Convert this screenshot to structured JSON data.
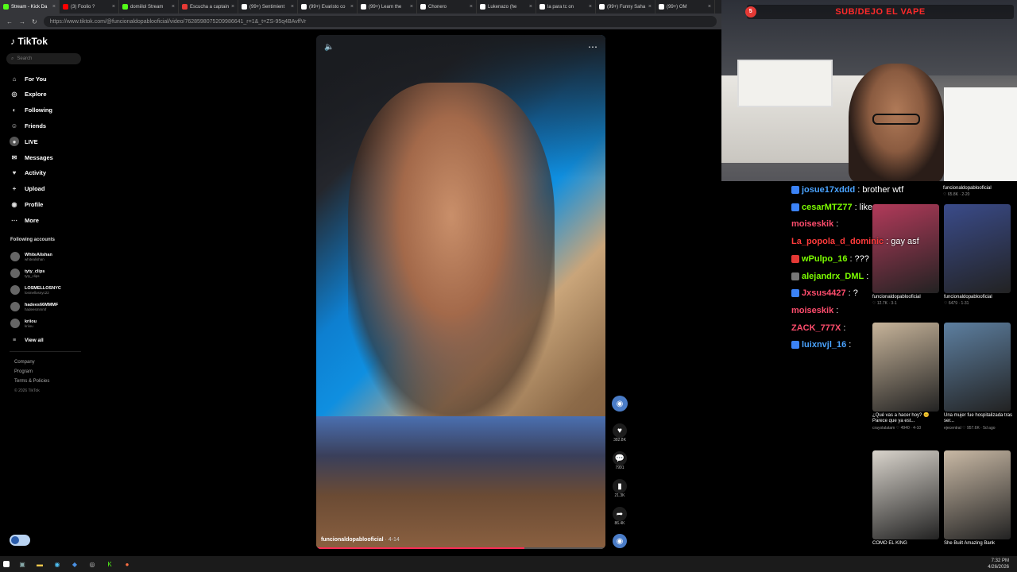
{
  "browser": {
    "tabs": [
      {
        "label": "Stream - Kick Da",
        "color": "#53fc18"
      },
      {
        "label": "(3) Foolio ?",
        "color": "#ff0000"
      },
      {
        "label": "domiilol Stream",
        "color": "#53fc18"
      },
      {
        "label": "Escucha a captain",
        "color": "#e53935"
      },
      {
        "label": "(99+) Sentimient",
        "color": "#ffffff"
      },
      {
        "label": "(99+) Evaristo co",
        "color": "#ffffff"
      },
      {
        "label": "(99+) Learn the",
        "color": "#ffffff"
      },
      {
        "label": "Chonero",
        "color": "#ffffff"
      },
      {
        "label": "Lukenazo (he",
        "color": "#ffffff"
      },
      {
        "label": "la para tc on",
        "color": "#ffffff"
      },
      {
        "label": "(99+) Funny Saha",
        "color": "#ffffff"
      },
      {
        "label": "(99+) OM",
        "color": "#ffffff"
      }
    ],
    "url": "https://www.tiktok.com/@funcionaldopablooficial/video/7628598075209986641_r=1&_t=ZS-95q4BAvffVr"
  },
  "sidebar": {
    "logo": "TikTok",
    "search_placeholder": "Search",
    "nav": [
      {
        "label": "For You",
        "icon": "home-icon",
        "glyph": "⌂"
      },
      {
        "label": "Explore",
        "icon": "compass-icon",
        "glyph": "◎"
      },
      {
        "label": "Following",
        "icon": "following-icon",
        "glyph": "◐"
      },
      {
        "label": "Friends",
        "icon": "friends-icon",
        "glyph": "☺"
      },
      {
        "label": "LIVE",
        "icon": "live-icon",
        "glyph": "●"
      },
      {
        "label": "Messages",
        "icon": "messages-icon",
        "glyph": "✉"
      },
      {
        "label": "Activity",
        "icon": "activity-icon",
        "glyph": "♥"
      },
      {
        "label": "Upload",
        "icon": "upload-icon",
        "glyph": "+"
      },
      {
        "label": "Profile",
        "icon": "profile-icon",
        "glyph": "◉"
      },
      {
        "label": "More",
        "icon": "more-icon",
        "glyph": "⋯"
      }
    ],
    "following_title": "Following accounts",
    "accounts": [
      {
        "name": "WhiteAlishan",
        "handle": "whitealishan"
      },
      {
        "name": "tyty_clips",
        "handle": "tyty_clips"
      },
      {
        "name": "LOSMELLOSNYC",
        "handle": "losmellosnyc22"
      },
      {
        "name": "hadees66MMMF",
        "handle": "hadeesmmmf"
      },
      {
        "name": "kriiou",
        "handle": "kriiou"
      }
    ],
    "view_all": "View all",
    "footer": [
      "Company",
      "Program",
      "Terms & Policies"
    ],
    "copyright": "© 2026 TikTok"
  },
  "video": {
    "author": "funcionaldopablooficial",
    "date": "· 4-14",
    "progress": 0.72,
    "likes": "382.8K",
    "comments": "7991",
    "saves": "21.3K",
    "shares": "86.4K"
  },
  "stream": {
    "banner": "SUB/DEJO EL VAPE"
  },
  "chat": [
    {
      "user": "josue17xddd",
      "text": "brother wtf",
      "color": "#4aa3ff",
      "badge": "#3b82f6"
    },
    {
      "user": "cesarMTZ77",
      "text": "like",
      "color": "#7cfc00",
      "badge": "#3b82f6"
    },
    {
      "user": "moiseskik",
      "text": "",
      "color": "#ff4d6d",
      "badge": ""
    },
    {
      "user": "La_popola_d_dominic",
      "text": "gay asf",
      "color": "#ff3b3b",
      "badge": ""
    },
    {
      "user": "wPulpo_16",
      "text": "???",
      "color": "#7cfc00",
      "badge": "#e53935"
    },
    {
      "user": "alejandrx_DML",
      "text": "",
      "color": "#7cfc00",
      "badge": "#777777"
    },
    {
      "user": "Jxsus4427",
      "text": "?",
      "color": "#ff4d6d",
      "badge": "#3b82f6"
    },
    {
      "user": "moiseskik",
      "text": "",
      "color": "#ff4d6d",
      "badge": ""
    },
    {
      "user": "ZACK_777X",
      "text": "",
      "color": "#ff4d6d",
      "badge": ""
    },
    {
      "user": "luixnvjl_16",
      "text": "",
      "color": "#4aa3ff",
      "badge": "#3b82f6"
    }
  ],
  "related": [
    {
      "caption": "funcionaldopablooficial",
      "sub": "♡ 65.8K · 2-20",
      "bg": "#1a1a1a"
    },
    {
      "caption": "funcionaldopablooficial",
      "sub": "♡ 12.7K · 3-1",
      "bg": "#b23a5a"
    },
    {
      "caption": "funcionaldopablooficial",
      "sub": "♡ 6479 · 1-31",
      "bg": "#3a4b8a"
    },
    {
      "caption": "¿Qué vas a hacer hoy? 😊 Parece que ya est...",
      "sub": "crayolalatam  ♡ 4940 · 4-10",
      "bg": "#c7b49a"
    },
    {
      "caption": "Una mujer fue hospitalizada tras ser...",
      "sub": "ejecentral  ♡ 957.6K · 5d ago",
      "bg": "#5d7fa0"
    },
    {
      "caption": "COMO EL KING",
      "sub": "",
      "bg": "#d9d4cc"
    },
    {
      "caption": "She Built Amazing Bank",
      "sub": "",
      "bg": "#c9b9a5"
    }
  ],
  "taskbar": {
    "time": "7:32 PM",
    "date": "4/26/2026"
  }
}
